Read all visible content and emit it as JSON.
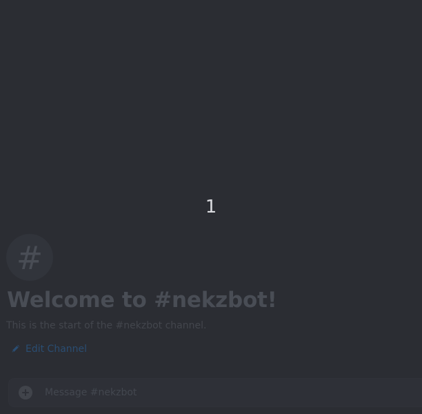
{
  "overlay": {
    "counter": "1"
  },
  "channel_intro": {
    "icon_glyph": "#",
    "title": "Welcome to #nekzbot!",
    "subtitle": "This is the start of the #nekzbot channel.",
    "edit_label": "Edit Channel"
  },
  "composer": {
    "placeholder": "Message #nekzbot",
    "value": ""
  },
  "icons": {
    "edit": "pencil-icon",
    "add": "plus-circle-icon",
    "channel": "hashtag-icon"
  },
  "colors": {
    "background": "#2b2d33",
    "link": "#2a4d72"
  }
}
